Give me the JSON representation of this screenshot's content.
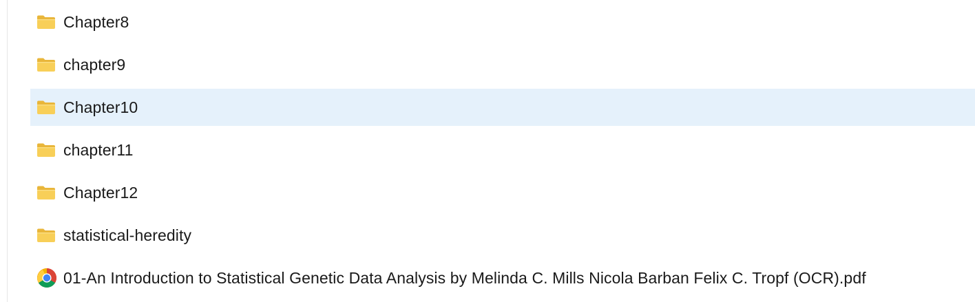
{
  "files": [
    {
      "name": "Chapter8",
      "icon": "folder-icon",
      "selected": false
    },
    {
      "name": "chapter9",
      "icon": "folder-icon",
      "selected": false
    },
    {
      "name": "Chapter10",
      "icon": "folder-icon",
      "selected": true
    },
    {
      "name": "chapter11",
      "icon": "folder-icon",
      "selected": false
    },
    {
      "name": "Chapter12",
      "icon": "folder-icon",
      "selected": false
    },
    {
      "name": "statistical-heredity",
      "icon": "folder-icon",
      "selected": false
    },
    {
      "name": "01-An Introduction to Statistical Genetic Data Analysis by Melinda C. Mills Nicola Barban Felix C. Tropf (OCR).pdf",
      "icon": "chrome-pdf-icon",
      "selected": false
    }
  ],
  "colors": {
    "selection": "#e5f1fb",
    "folder": "#f8c84a",
    "text": "#1a1a1a"
  }
}
